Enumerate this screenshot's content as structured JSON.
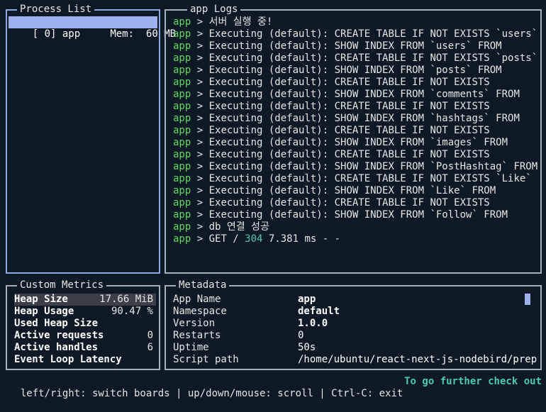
{
  "process_list": {
    "title": "Process List",
    "items": [
      {
        "index": "[ 0]",
        "name": "app",
        "mem_label": "Mem:",
        "mem_value": "60 MB"
      }
    ]
  },
  "logs": {
    "title": "app Logs",
    "lines": [
      {
        "prefix": "app",
        "text": " > 서버 실행 중!"
      },
      {
        "prefix": "app",
        "text": " > Executing (default): CREATE TABLE IF NOT EXISTS `users`"
      },
      {
        "prefix": "app",
        "text": " > Executing (default): SHOW INDEX FROM `users` FROM"
      },
      {
        "prefix": "app",
        "text": " > Executing (default): CREATE TABLE IF NOT EXISTS `posts`"
      },
      {
        "prefix": "app",
        "text": " > Executing (default): SHOW INDEX FROM `posts` FROM"
      },
      {
        "prefix": "app",
        "text": " > Executing (default): CREATE TABLE IF NOT EXISTS"
      },
      {
        "prefix": "app",
        "text": " > Executing (default): SHOW INDEX FROM `comments` FROM"
      },
      {
        "prefix": "app",
        "text": " > Executing (default): CREATE TABLE IF NOT EXISTS"
      },
      {
        "prefix": "app",
        "text": " > Executing (default): SHOW INDEX FROM `hashtags` FROM"
      },
      {
        "prefix": "app",
        "text": " > Executing (default): CREATE TABLE IF NOT EXISTS"
      },
      {
        "prefix": "app",
        "text": " > Executing (default): SHOW INDEX FROM `images` FROM"
      },
      {
        "prefix": "app",
        "text": " > Executing (default): CREATE TABLE IF NOT EXISTS"
      },
      {
        "prefix": "app",
        "text": " > Executing (default): SHOW INDEX FROM `PostHashtag` FROM"
      },
      {
        "prefix": "app",
        "text": " > Executing (default): CREATE TABLE IF NOT EXISTS `Like`"
      },
      {
        "prefix": "app",
        "text": " > Executing (default): SHOW INDEX FROM `Like` FROM"
      },
      {
        "prefix": "app",
        "text": " > Executing (default): CREATE TABLE IF NOT EXISTS"
      },
      {
        "prefix": "app",
        "text": " > Executing (default): SHOW INDEX FROM `Follow` FROM"
      },
      {
        "prefix": "app",
        "text": " > db 연결 성공"
      },
      {
        "prefix": "app",
        "text": " > GET / ",
        "status": "304",
        "suffix": " 7.381 ms - -"
      }
    ]
  },
  "custom_metrics": {
    "title": "Custom Metrics",
    "rows": [
      {
        "label": "Heap Size",
        "value": "17.66 MiB"
      },
      {
        "label": "Heap Usage",
        "value": "90.47 %"
      },
      {
        "label": "Used Heap Size",
        "value": ""
      },
      {
        "label": "Active requests",
        "value": "0"
      },
      {
        "label": "Active handles",
        "value": "6"
      },
      {
        "label": "Event Loop Latency",
        "value": ""
      }
    ]
  },
  "metadata": {
    "title": "Metadata",
    "rows": [
      {
        "key": "App Name",
        "value": "app"
      },
      {
        "key": "Namespace",
        "value": "default"
      },
      {
        "key": "Version",
        "value": "1.0.0"
      },
      {
        "key": "Restarts",
        "value": "0"
      },
      {
        "key": "Uptime",
        "value": "50s"
      },
      {
        "key": "Script path",
        "value": "/home/ubuntu/react-next-js-nodebird/prep"
      }
    ]
  },
  "footer": {
    "hint": "left/right: switch boards | up/down/mouse: scroll | Ctrl-C: exit",
    "right": "To go further check out"
  },
  "colors": {
    "background": "#0d1a26",
    "border_active": "#8fa6e6",
    "border": "#a8aeb6",
    "selection": "#9fb0ef",
    "prefix_green": "#5fd75f",
    "status_cyan": "#4ec9b0"
  }
}
